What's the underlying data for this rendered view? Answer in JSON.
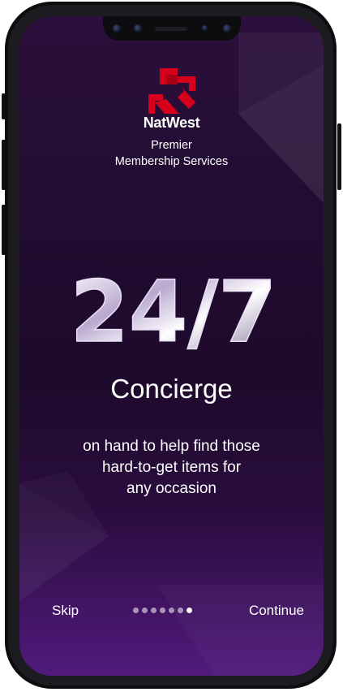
{
  "brand": {
    "name": "NatWest",
    "subtitle_line1": "Premier",
    "subtitle_line2": "Membership Services",
    "logo_color": "#d6001c"
  },
  "feature": {
    "big_text": "24/7",
    "heading": "Concierge",
    "description_lines": [
      "on hand to help find those",
      "hard-to-get items for",
      "any occasion"
    ]
  },
  "footer": {
    "skip_label": "Skip",
    "continue_label": "Continue",
    "pager": {
      "total": 7,
      "active_index": 6
    }
  },
  "colors": {
    "background_top": "#2b0f3c",
    "background_bottom": "#521a7c",
    "text": "#ffffff"
  }
}
